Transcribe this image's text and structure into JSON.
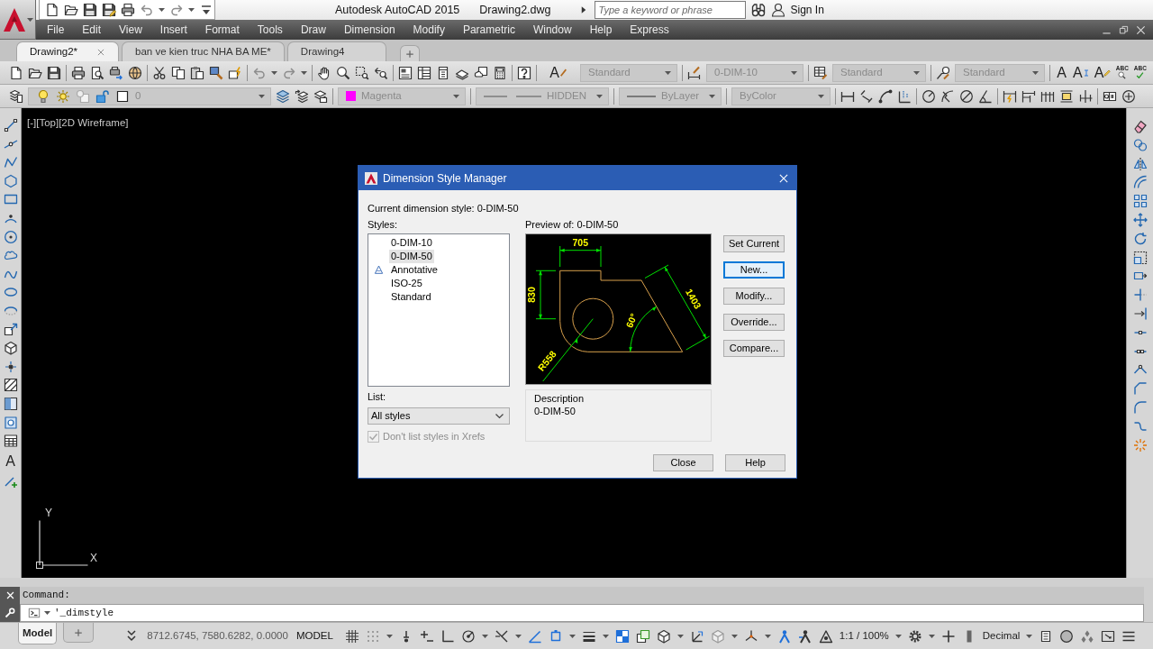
{
  "title_bar": {
    "app_title": "Autodesk AutoCAD 2015",
    "document": "Drawing2.dwg",
    "search": {
      "placeholder": "Type a keyword or phrase"
    },
    "sign_in": "Sign In"
  },
  "menu": [
    "File",
    "Edit",
    "View",
    "Insert",
    "Format",
    "Tools",
    "Draw",
    "Dimension",
    "Modify",
    "Parametric",
    "Window",
    "Help",
    "Express"
  ],
  "file_tabs": [
    {
      "label": "Drawing2*",
      "selected": true
    },
    {
      "label": "ban ve kien truc NHA BA ME*",
      "selected": false
    },
    {
      "label": "Drawing4",
      "selected": false
    }
  ],
  "toolbar_top": {
    "text_style": {
      "glyph": "A",
      "value": "Standard"
    },
    "dimension_style": "0-DIM-10",
    "table_style": "Standard",
    "multileader_style": "Standard",
    "text_tools": [
      {
        "kind": "plain",
        "glyph": "A"
      },
      {
        "kind": "cursor",
        "glyph": "A"
      },
      {
        "kind": "edit",
        "glyph": "A"
      },
      {
        "kind": "find",
        "glyph": "ABC"
      },
      {
        "kind": "spell",
        "glyph": "ABC"
      }
    ]
  },
  "toolbar_bottom": {
    "layer": "0",
    "color": {
      "label": "Magenta",
      "color": "#ff00ff"
    },
    "linetype": "HIDDEN",
    "lineweight": "ByLayer",
    "plot_style": "ByColor"
  },
  "draw_toolbar": {
    "text_glyph": "A"
  },
  "viewport_label": "[-][Top][2D Wireframe]",
  "ucs": {
    "x": "X",
    "y": "Y"
  },
  "dialog": {
    "title": "Dimension Style Manager",
    "current_style": "Current dimension style: 0-DIM-50",
    "styles_label": "Styles:",
    "styles": [
      {
        "name": "0-DIM-10",
        "selected": false,
        "annotative": false
      },
      {
        "name": "0-DIM-50",
        "selected": true,
        "annotative": false
      },
      {
        "name": "Annotative",
        "selected": false,
        "annotative": true
      },
      {
        "name": "ISO-25",
        "selected": false,
        "annotative": false
      },
      {
        "name": "Standard",
        "selected": false,
        "annotative": false
      }
    ],
    "list_label": "List:",
    "list_filter": "All styles",
    "xref_option": {
      "label": "Don't list styles in Xrefs",
      "checked": true,
      "disabled": true
    },
    "preview_label": "Preview of: 0-DIM-50",
    "preview_dimensions": [
      "705",
      "830",
      "1403",
      "60°",
      "R558"
    ],
    "side_buttons": [
      {
        "label": "Set Current",
        "focused": false
      },
      {
        "label": "New...",
        "focused": true
      },
      {
        "label": "Modify...",
        "focused": false
      },
      {
        "label": "Override...",
        "focused": false
      },
      {
        "label": "Compare...",
        "focused": false
      }
    ],
    "description": {
      "label": "Description",
      "text": "0-DIM-50"
    },
    "footer_buttons": [
      "Close",
      "Help"
    ]
  },
  "command_line": {
    "label": "Command:",
    "input": "'_dimstyle"
  },
  "status_bar": {
    "layout_tabs": [
      {
        "label": "Model",
        "selected": true
      }
    ],
    "coordinates": "8712.6745, 7580.6282, 0.0000",
    "space": "MODEL",
    "annotation_scale": "1:1 / 100%",
    "units": "Decimal"
  }
}
